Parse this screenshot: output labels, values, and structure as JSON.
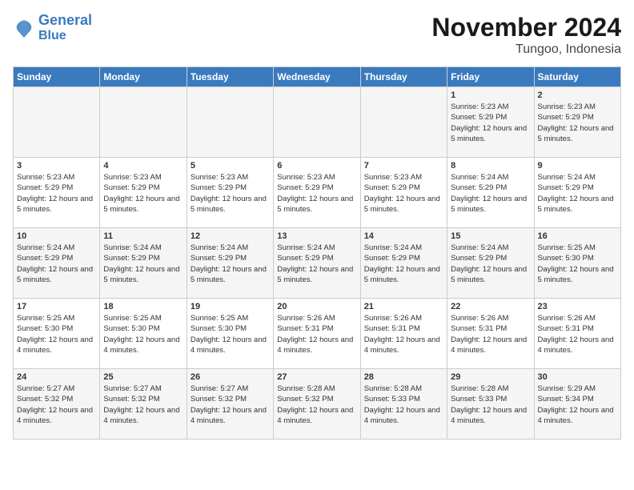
{
  "logo": {
    "line1": "General",
    "line2": "Blue"
  },
  "title": "November 2024",
  "location": "Tungoo, Indonesia",
  "days_header": [
    "Sunday",
    "Monday",
    "Tuesday",
    "Wednesday",
    "Thursday",
    "Friday",
    "Saturday"
  ],
  "weeks": [
    [
      {
        "day": "",
        "info": ""
      },
      {
        "day": "",
        "info": ""
      },
      {
        "day": "",
        "info": ""
      },
      {
        "day": "",
        "info": ""
      },
      {
        "day": "",
        "info": ""
      },
      {
        "day": "1",
        "info": "Sunrise: 5:23 AM\nSunset: 5:29 PM\nDaylight: 12 hours and 5 minutes."
      },
      {
        "day": "2",
        "info": "Sunrise: 5:23 AM\nSunset: 5:29 PM\nDaylight: 12 hours and 5 minutes."
      }
    ],
    [
      {
        "day": "3",
        "info": "Sunrise: 5:23 AM\nSunset: 5:29 PM\nDaylight: 12 hours and 5 minutes."
      },
      {
        "day": "4",
        "info": "Sunrise: 5:23 AM\nSunset: 5:29 PM\nDaylight: 12 hours and 5 minutes."
      },
      {
        "day": "5",
        "info": "Sunrise: 5:23 AM\nSunset: 5:29 PM\nDaylight: 12 hours and 5 minutes."
      },
      {
        "day": "6",
        "info": "Sunrise: 5:23 AM\nSunset: 5:29 PM\nDaylight: 12 hours and 5 minutes."
      },
      {
        "day": "7",
        "info": "Sunrise: 5:23 AM\nSunset: 5:29 PM\nDaylight: 12 hours and 5 minutes."
      },
      {
        "day": "8",
        "info": "Sunrise: 5:24 AM\nSunset: 5:29 PM\nDaylight: 12 hours and 5 minutes."
      },
      {
        "day": "9",
        "info": "Sunrise: 5:24 AM\nSunset: 5:29 PM\nDaylight: 12 hours and 5 minutes."
      }
    ],
    [
      {
        "day": "10",
        "info": "Sunrise: 5:24 AM\nSunset: 5:29 PM\nDaylight: 12 hours and 5 minutes."
      },
      {
        "day": "11",
        "info": "Sunrise: 5:24 AM\nSunset: 5:29 PM\nDaylight: 12 hours and 5 minutes."
      },
      {
        "day": "12",
        "info": "Sunrise: 5:24 AM\nSunset: 5:29 PM\nDaylight: 12 hours and 5 minutes."
      },
      {
        "day": "13",
        "info": "Sunrise: 5:24 AM\nSunset: 5:29 PM\nDaylight: 12 hours and 5 minutes."
      },
      {
        "day": "14",
        "info": "Sunrise: 5:24 AM\nSunset: 5:29 PM\nDaylight: 12 hours and 5 minutes."
      },
      {
        "day": "15",
        "info": "Sunrise: 5:24 AM\nSunset: 5:29 PM\nDaylight: 12 hours and 5 minutes."
      },
      {
        "day": "16",
        "info": "Sunrise: 5:25 AM\nSunset: 5:30 PM\nDaylight: 12 hours and 5 minutes."
      }
    ],
    [
      {
        "day": "17",
        "info": "Sunrise: 5:25 AM\nSunset: 5:30 PM\nDaylight: 12 hours and 4 minutes."
      },
      {
        "day": "18",
        "info": "Sunrise: 5:25 AM\nSunset: 5:30 PM\nDaylight: 12 hours and 4 minutes."
      },
      {
        "day": "19",
        "info": "Sunrise: 5:25 AM\nSunset: 5:30 PM\nDaylight: 12 hours and 4 minutes."
      },
      {
        "day": "20",
        "info": "Sunrise: 5:26 AM\nSunset: 5:31 PM\nDaylight: 12 hours and 4 minutes."
      },
      {
        "day": "21",
        "info": "Sunrise: 5:26 AM\nSunset: 5:31 PM\nDaylight: 12 hours and 4 minutes."
      },
      {
        "day": "22",
        "info": "Sunrise: 5:26 AM\nSunset: 5:31 PM\nDaylight: 12 hours and 4 minutes."
      },
      {
        "day": "23",
        "info": "Sunrise: 5:26 AM\nSunset: 5:31 PM\nDaylight: 12 hours and 4 minutes."
      }
    ],
    [
      {
        "day": "24",
        "info": "Sunrise: 5:27 AM\nSunset: 5:32 PM\nDaylight: 12 hours and 4 minutes."
      },
      {
        "day": "25",
        "info": "Sunrise: 5:27 AM\nSunset: 5:32 PM\nDaylight: 12 hours and 4 minutes."
      },
      {
        "day": "26",
        "info": "Sunrise: 5:27 AM\nSunset: 5:32 PM\nDaylight: 12 hours and 4 minutes."
      },
      {
        "day": "27",
        "info": "Sunrise: 5:28 AM\nSunset: 5:32 PM\nDaylight: 12 hours and 4 minutes."
      },
      {
        "day": "28",
        "info": "Sunrise: 5:28 AM\nSunset: 5:33 PM\nDaylight: 12 hours and 4 minutes."
      },
      {
        "day": "29",
        "info": "Sunrise: 5:28 AM\nSunset: 5:33 PM\nDaylight: 12 hours and 4 minutes."
      },
      {
        "day": "30",
        "info": "Sunrise: 5:29 AM\nSunset: 5:34 PM\nDaylight: 12 hours and 4 minutes."
      }
    ]
  ]
}
